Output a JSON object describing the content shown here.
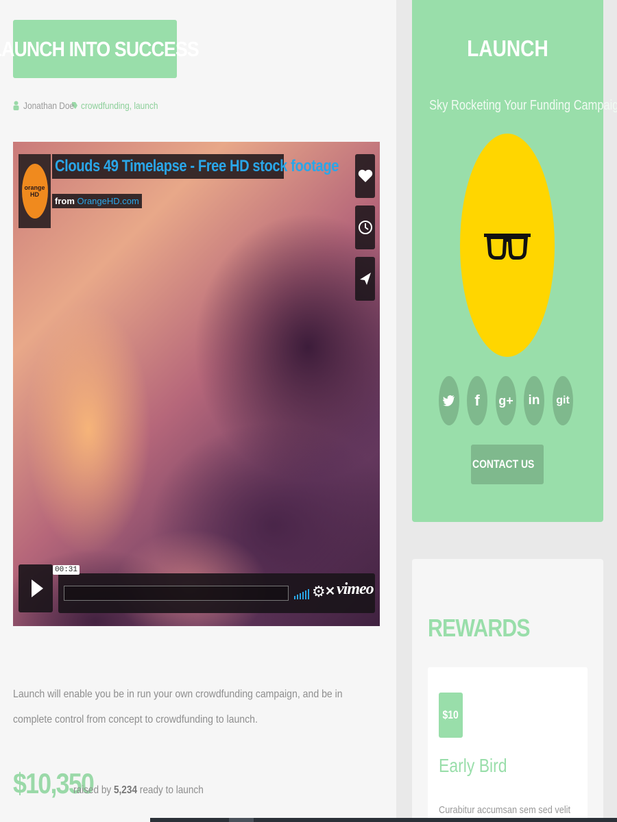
{
  "post": {
    "title": "LAUNCH INTO SUCCESS",
    "author": "Jonathan Doe",
    "tags": "crowdfunding, launch",
    "description": "Launch will enable you be in run your own crowdfunding campaign, and be in complete control from concept to crowdfunding to launch.",
    "raised_amount": "$10,350",
    "raised_by_label": "raised by",
    "backers": "5,234",
    "ready_label": "ready to launch"
  },
  "video": {
    "title": "Clouds 49 Timelapse - Free HD stock footage",
    "from_label": "from",
    "from_link": "OrangeHD.com",
    "logo_text": "orange HD",
    "timecode": "00:31",
    "brand": "vimeo"
  },
  "sidebar": {
    "heading": "LAUNCH",
    "tagline": "Sky Rocketing Your Funding Campaign",
    "social": [
      {
        "name": "twitter-icon",
        "glyph": "🐦"
      },
      {
        "name": "facebook-icon",
        "glyph": "f"
      },
      {
        "name": "google-plus-icon",
        "glyph": "g+"
      },
      {
        "name": "linkedin-icon",
        "glyph": "in"
      },
      {
        "name": "git-icon",
        "glyph": "git"
      }
    ],
    "contact_label": "CONTACT US"
  },
  "rewards": {
    "heading": "REWARDS",
    "items": [
      {
        "price": "$10",
        "name": "Early Bird",
        "text": "Curabitur accumsan sem sed velit"
      }
    ]
  },
  "colors": {
    "accent": "#99deaa",
    "accent_dark": "#7fb98d",
    "avatar_bg": "#ffd600",
    "video_link": "#2aa6e8"
  }
}
